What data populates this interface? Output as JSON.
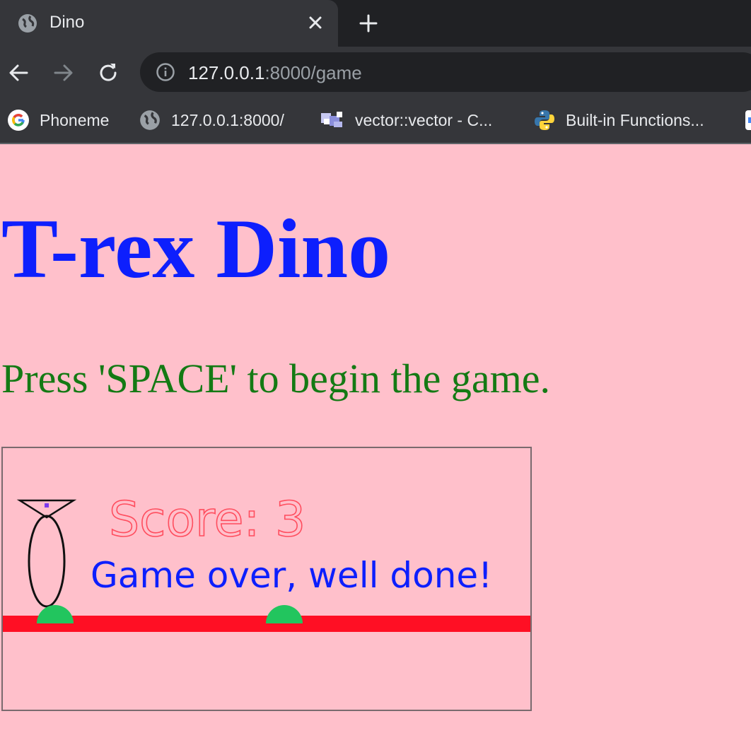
{
  "browser": {
    "tab": {
      "title": "Dino",
      "favicon": "globe-icon"
    },
    "new_tab_icon": "plus-icon",
    "address": {
      "host": "127.0.0.1",
      "rest": ":8000/game"
    },
    "bookmarks": [
      {
        "label": "Phoneme",
        "icon": "google-icon"
      },
      {
        "label": "127.0.0.1:8000/",
        "icon": "globe-icon"
      },
      {
        "label": "vector::vector - C...",
        "icon": "cplusplus-icon"
      },
      {
        "label": "Built-in Functions...",
        "icon": "python-icon"
      }
    ]
  },
  "page": {
    "title": "T-rex Dino",
    "instructions": "Press 'SPACE' to begin the game."
  },
  "game": {
    "score_text": "Score: 3",
    "game_over_text": "Game over, well done!",
    "colors": {
      "background": "#ffc0cb",
      "ground": "#ff0f24",
      "obstacle": "#22c55e",
      "score": "#ff4d5e",
      "message": "#0d1ffd",
      "dino_eye": "#7c3aed"
    }
  }
}
